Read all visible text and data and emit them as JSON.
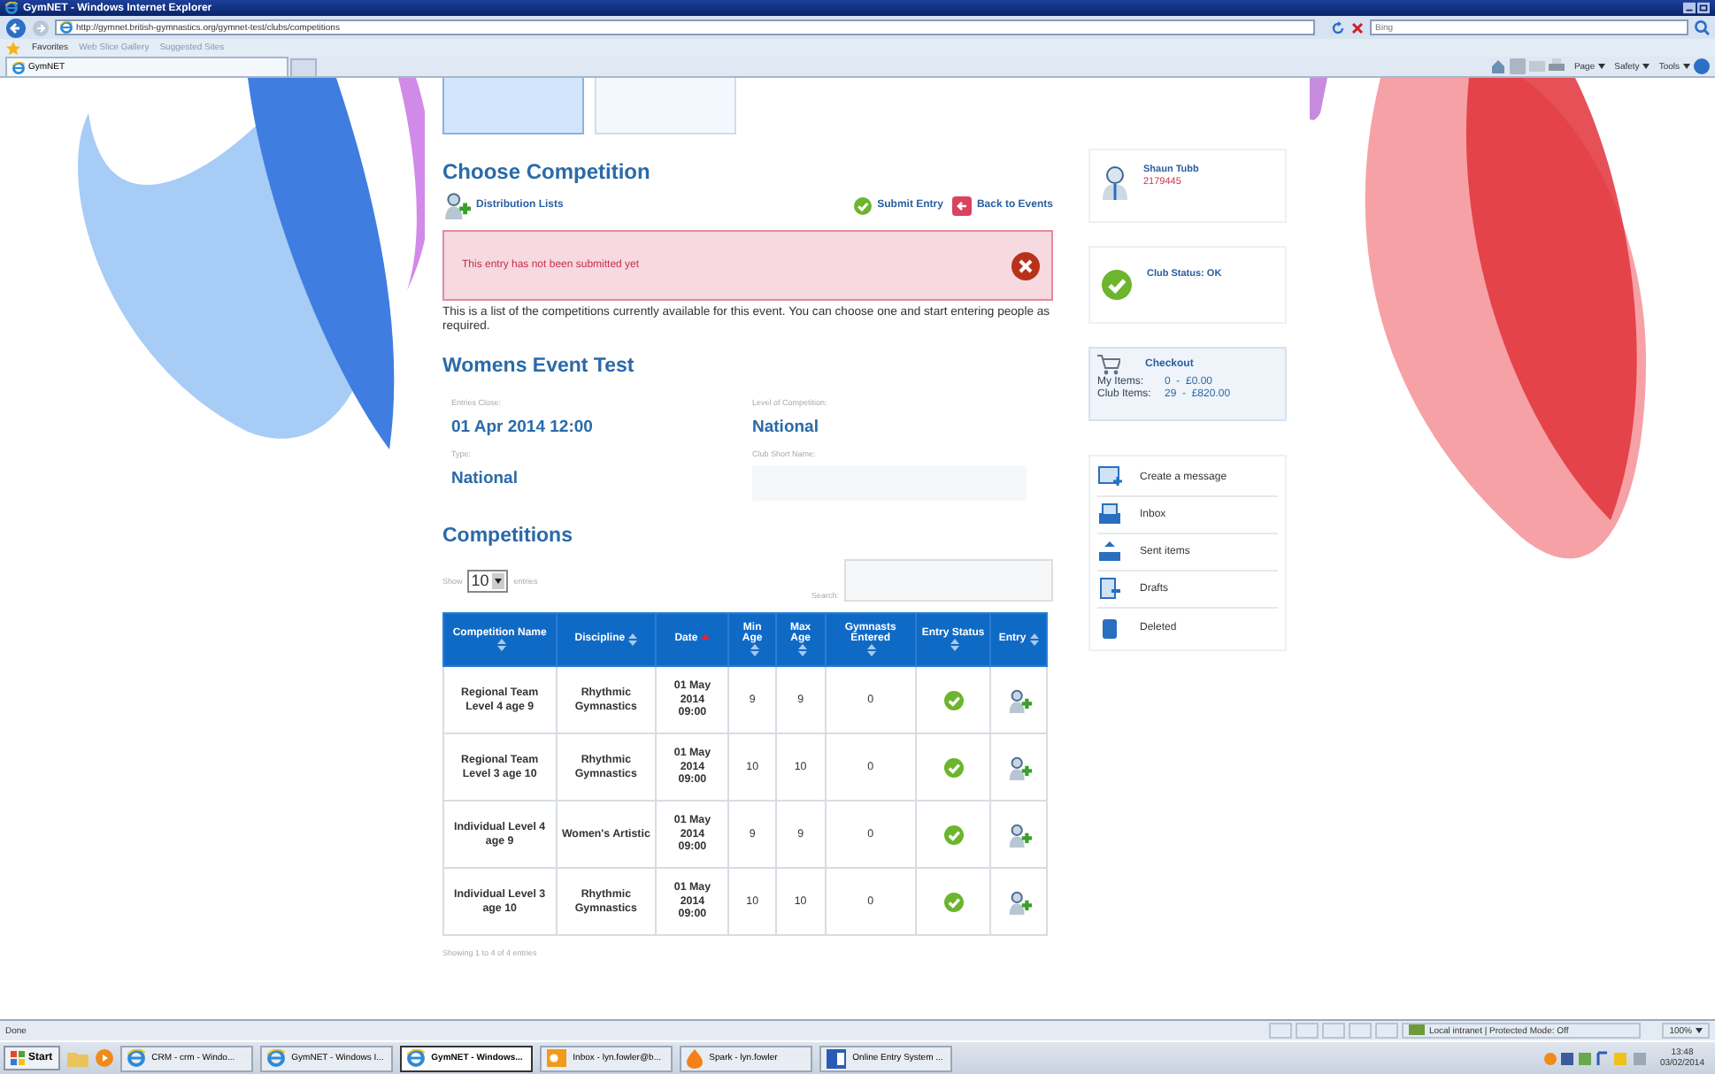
{
  "window": {
    "title": "GymNET - Windows Internet Explorer"
  },
  "address_bar": {
    "url": "http://gymnet.british-gymnastics.org/gymnet-test/clubs/competitions",
    "search_placeholder": "Bing"
  },
  "favorites_bar": {
    "label": "Favorites",
    "links": [
      "Web Slice Gallery",
      "Suggested Sites"
    ]
  },
  "tab": {
    "label": "GymNET"
  },
  "command_bar": [
    "Page",
    "Safety",
    "Tools"
  ],
  "page_tabs": [
    {
      "selected": true
    },
    {
      "selected": false
    }
  ],
  "heading": "Choose Competition",
  "actions": {
    "distribution": "Distribution Lists",
    "submit": "Submit Entry",
    "back": "Back to Events"
  },
  "alert": "This entry has not been submitted yet",
  "intro": "This is a list of the competitions currently available for this event. You can choose one and start entering people as required.",
  "event": {
    "title": "Womens Event Test",
    "fields": [
      {
        "label": "Entries Close:",
        "value": "01 Apr 2014 12:00"
      },
      {
        "label": "Level of Competition:",
        "value": "National"
      },
      {
        "label": "Type:",
        "value": "National"
      },
      {
        "label": "Club Short Name:"
      }
    ]
  },
  "competitions": {
    "title": "Competitions",
    "show_label": "Show",
    "page_size": "10",
    "entries_label": "entries",
    "search_label": "Search:",
    "columns": [
      {
        "label": "Competition Name",
        "sorted": false
      },
      {
        "label": "Discipline",
        "sorted": false
      },
      {
        "label": "Date",
        "sorted": true
      },
      {
        "label": "Min Age",
        "sorted": false
      },
      {
        "label": "Max Age",
        "sorted": false
      },
      {
        "label": "Gymnasts Entered",
        "sorted": false
      },
      {
        "label": "Entry Status",
        "sorted": false
      },
      {
        "label": "Entry",
        "sorted": false
      }
    ],
    "rows": [
      {
        "name": "Regional Team Level 4 age 9",
        "discipline": "Rhythmic Gymnastics",
        "date": "01 May 2014 09:00",
        "min_age": "9",
        "max_age": "9",
        "gymnasts": "0",
        "status_ok": true
      },
      {
        "name": "Regional Team Level 3 age 10",
        "discipline": "Rhythmic Gymnastics",
        "date": "01 May 2014 09:00",
        "min_age": "10",
        "max_age": "10",
        "gymnasts": "0",
        "status_ok": true
      },
      {
        "name": "Individual Level 4 age 9",
        "discipline": "Women's Artistic",
        "date": "01 May 2014 09:00",
        "min_age": "9",
        "max_age": "9",
        "gymnasts": "0",
        "status_ok": true
      },
      {
        "name": "Individual Level 3 age 10",
        "discipline": "Rhythmic Gymnastics",
        "date": "01 May 2014 09:00",
        "min_age": "10",
        "max_age": "10",
        "gymnasts": "0",
        "status_ok": true
      }
    ],
    "footer": "Showing 1 to 4 of 4 entries"
  },
  "user": {
    "name": "Shaun Tubb",
    "number": "2179445"
  },
  "club_status": "Club Status: OK",
  "checkout": {
    "title": "Checkout",
    "lines": [
      {
        "label": "My Items:",
        "value": "0  -  £0.00"
      },
      {
        "label": "Club Items:",
        "value": "29  -  £820.00"
      }
    ]
  },
  "messages": [
    {
      "kind": "create",
      "label": "Create a message"
    },
    {
      "kind": "inbox",
      "label": "Inbox"
    },
    {
      "kind": "sent",
      "label": "Sent items"
    },
    {
      "kind": "drafts",
      "label": "Drafts"
    },
    {
      "kind": "deleted",
      "label": "Deleted"
    }
  ],
  "status_bar": {
    "text": "Done",
    "zone": "Local intranet | Protected Mode: Off",
    "zoom": "100%"
  },
  "taskbar": {
    "start": "Start",
    "items": [
      {
        "label": "CRM - crm  - Windo...",
        "kind": "ie",
        "selected": false
      },
      {
        "label": "GymNET - Windows I...",
        "kind": "ie",
        "selected": false
      },
      {
        "label": "GymNET - Windows...",
        "kind": "ie",
        "selected": true
      },
      {
        "label": "Inbox - lyn.fowler@b...",
        "kind": "outlook",
        "selected": false
      },
      {
        "label": "Spark - lyn.fowler",
        "kind": "spark",
        "selected": false
      },
      {
        "label": "Online Entry System ...",
        "kind": "word",
        "selected": false
      }
    ],
    "time": "13:48",
    "date": "03/02/2014"
  }
}
